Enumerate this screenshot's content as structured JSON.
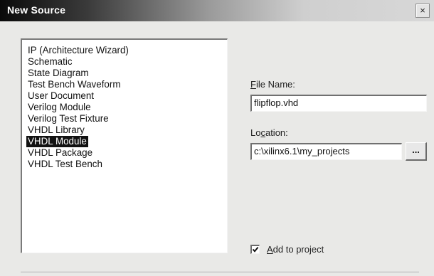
{
  "window": {
    "title": "New Source",
    "close_label": "×"
  },
  "source_types": [
    {
      "label": "IP (Architecture Wizard)",
      "selected": false
    },
    {
      "label": "Schematic",
      "selected": false
    },
    {
      "label": "State Diagram",
      "selected": false
    },
    {
      "label": "Test Bench Waveform",
      "selected": false
    },
    {
      "label": "User Document",
      "selected": false
    },
    {
      "label": "Verilog Module",
      "selected": false
    },
    {
      "label": "Verilog Test Fixture",
      "selected": false
    },
    {
      "label": "VHDL Library",
      "selected": false
    },
    {
      "label": "VHDL Module",
      "selected": true
    },
    {
      "label": "VHDL Package",
      "selected": false
    },
    {
      "label": "VHDL Test Bench",
      "selected": false
    }
  ],
  "file_name": {
    "label_accel": "F",
    "label_rest": "ile Name:",
    "value": "flipflop.vhd"
  },
  "location": {
    "label_pre": "Lo",
    "label_accel": "c",
    "label_rest": "ation:",
    "value": "c:\\xilinx6.1\\my_projects",
    "browse_label": "..."
  },
  "add_to_project": {
    "checked": true,
    "label_accel": "A",
    "label_rest": "dd to project"
  }
}
